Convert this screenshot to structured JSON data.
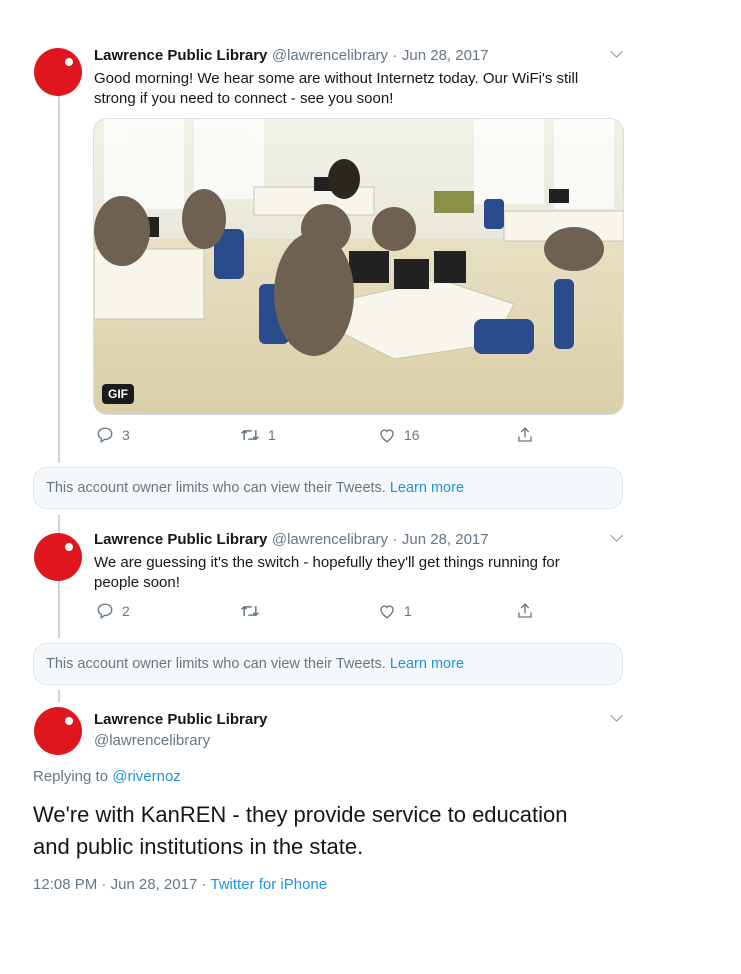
{
  "tweets": [
    {
      "author_name": "Lawrence Public Library",
      "author_handle": "@lawrencelibrary",
      "date": "Jun 28, 2017",
      "text_line1": "Good morning! We hear some are without Internetz today. Our WiFi's still",
      "text_line2": "strong if you need to connect - see you soon!",
      "media_badge": "GIF",
      "replies": "3",
      "retweets": "1",
      "likes": "16"
    },
    {
      "author_name": "Lawrence Public Library",
      "author_handle": "@lawrencelibrary",
      "date": "Jun 28, 2017",
      "text_line1": "We are guessing it's the switch - hopefully they'll get things running for",
      "text_line2": "people soon!",
      "replies": "2",
      "retweets": "",
      "likes": "1"
    }
  ],
  "notice": {
    "text": "This account owner limits who can view their Tweets.",
    "link": "Learn more"
  },
  "main_tweet": {
    "author_name": "Lawrence Public Library",
    "author_handle": "@lawrencelibrary",
    "replying_prefix": "Replying to",
    "replying_handle": "@rivernoz",
    "text_line1": "We're with KanREN - they provide service to education",
    "text_line2": "and public institutions in the state.",
    "time": "12:08 PM",
    "date": "Jun 28, 2017",
    "source": "Twitter for iPhone",
    "separator": "·"
  },
  "colors": {
    "avatar": "#e0161f",
    "link": "#1b95e0",
    "secondary_text": "#657786",
    "notice_bg": "#f5f8fa"
  },
  "icons": [
    "reply-icon",
    "retweet-icon",
    "like-icon",
    "share-icon",
    "chevron-down-icon"
  ]
}
